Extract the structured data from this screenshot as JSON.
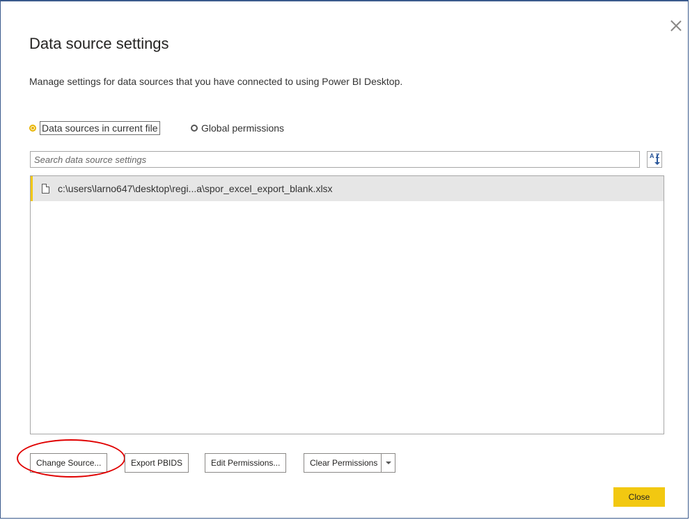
{
  "dialog": {
    "title": "Data source settings",
    "subtitle": "Manage settings for data sources that you have connected to using Power BI Desktop."
  },
  "scope": {
    "options": [
      {
        "label": "Data sources in current file",
        "selected": true
      },
      {
        "label": "Global permissions",
        "selected": false
      }
    ]
  },
  "search": {
    "placeholder": "Search data source settings",
    "value": ""
  },
  "sort": {
    "icon": "sort-az-icon",
    "glyph": "A Z"
  },
  "sources": [
    {
      "path": "c:\\users\\larno647\\desktop\\regi...a\\spor_excel_export_blank.xlsx",
      "icon": "file-icon",
      "selected": true
    }
  ],
  "actions": {
    "change_source": "Change Source...",
    "export_pbids": "Export PBIDS",
    "edit_permissions": "Edit Permissions...",
    "clear_permissions": "Clear Permissions"
  },
  "footer": {
    "close": "Close"
  },
  "colors": {
    "accent": "#f2c811",
    "highlight_annotation": "#e00000",
    "window_border": "#3a5a8c"
  }
}
